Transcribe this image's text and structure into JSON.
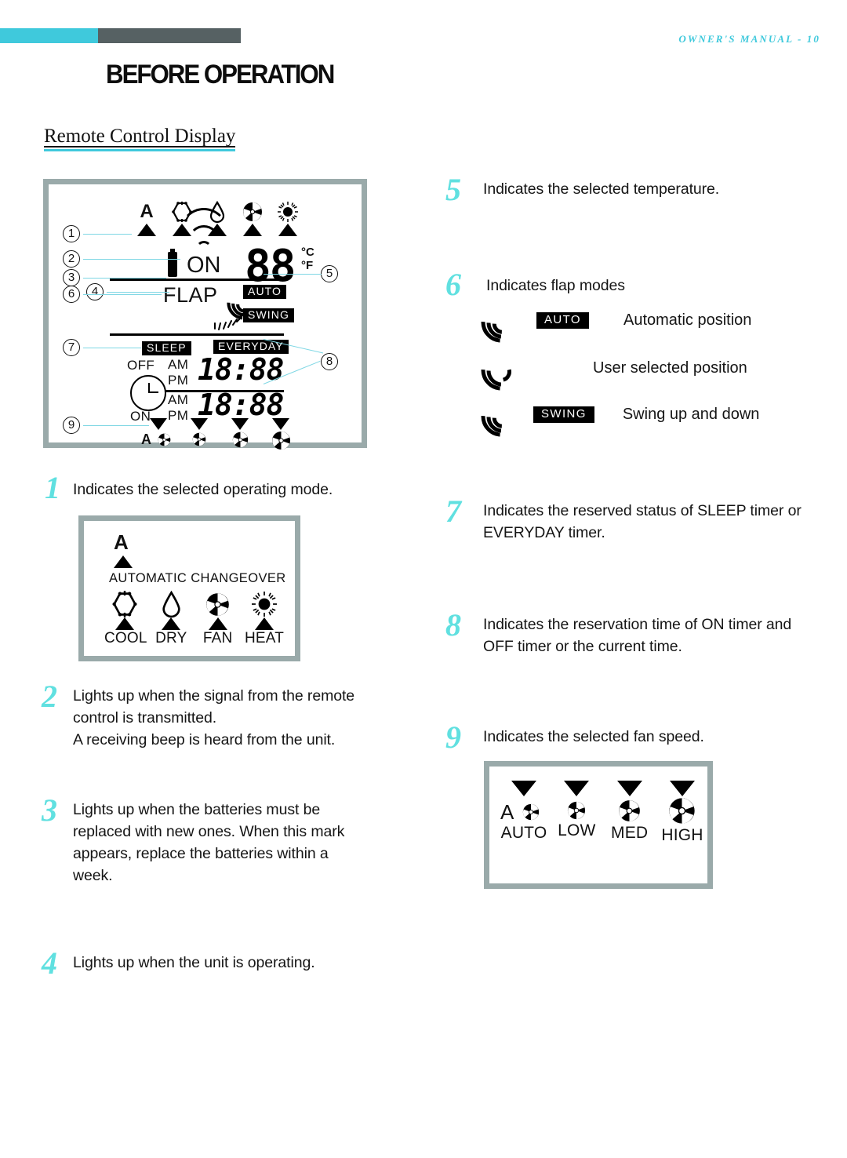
{
  "header": {
    "manual_tag": "OWNER'S MANUAL - 10",
    "page_title": "BEFORE OPERATION",
    "section_title": "Remote Control Display",
    "accent_cyan": "#3FC9DC",
    "accent_grey": "#566163",
    "number_cyan": "#60E0E0",
    "frame_grey": "#9AAAAA"
  },
  "lcd": {
    "mode_icons": [
      {
        "name": "automatic-changeover",
        "glyph": "A"
      },
      {
        "name": "cool-snowflake",
        "glyph": "snowflake"
      },
      {
        "name": "dry-droplet",
        "glyph": "droplet"
      },
      {
        "name": "fan-blade",
        "glyph": "fan"
      },
      {
        "name": "heat-sun",
        "glyph": "sun"
      }
    ],
    "on_label": "ON",
    "temp_value": "88",
    "temp_unit_c": "°C",
    "temp_unit_f": "°F",
    "flap_label": "FLAP",
    "auto_chip": "AUTO",
    "swing_chip": "SWING",
    "sleep_chip": "SLEEP",
    "everyday_chip": "EVERYDAY",
    "timer_off_label": "OFF",
    "timer_on_label": "ON",
    "am_label": "AM",
    "pm_label": "PM",
    "time_top": "18:88",
    "time_bottom": "18:88",
    "fan_speed_icons": [
      "A-fan",
      "fan-small",
      "fan-medium",
      "fan-large"
    ],
    "callouts": [
      "1",
      "2",
      "3",
      "4",
      "5",
      "6",
      "7",
      "8",
      "9"
    ]
  },
  "mode_box": {
    "auto_letter": "A",
    "auto_caption": "AUTOMATIC CHANGEOVER",
    "modes": [
      {
        "icon": "snowflake-icon",
        "label": "COOL"
      },
      {
        "icon": "droplet-icon",
        "label": "DRY"
      },
      {
        "icon": "fan-icon",
        "label": "FAN"
      },
      {
        "icon": "sun-icon",
        "label": "HEAT"
      }
    ]
  },
  "fan_box": {
    "speeds": [
      {
        "icon": "auto-fan-icon",
        "label": "AUTO"
      },
      {
        "icon": "low-fan-icon",
        "label": "LOW"
      },
      {
        "icon": "med-fan-icon",
        "label": "MED"
      },
      {
        "icon": "high-fan-icon",
        "label": "HIGH"
      }
    ]
  },
  "items": {
    "n1": {
      "num": "1",
      "text": "Indicates the selected operating mode."
    },
    "n2": {
      "num": "2",
      "line1": "Lights up when the signal from the remote",
      "line2": "control is transmitted.",
      "line3": "A receiving beep is heard from the unit."
    },
    "n3": {
      "num": "3",
      "line1": "Lights up when the batteries must be",
      "line2": "replaced with new ones. When this mark",
      "line3": "appears,  replace the batteries within a",
      "line4": "week."
    },
    "n4": {
      "num": "4",
      "text": "Lights up when the unit is operating."
    },
    "n5": {
      "num": "5",
      "text": "Indicates the selected temperature."
    },
    "n6": {
      "num": "6",
      "text": "Indicates flap modes",
      "rows": [
        {
          "chip": "AUTO",
          "desc": "Automatic position"
        },
        {
          "chip": "",
          "desc": "User selected position"
        },
        {
          "chip": "SWING",
          "desc": "Swing up and down"
        }
      ]
    },
    "n7": {
      "num": "7",
      "line1": "Indicates the reserved status of SLEEP timer or",
      "line2": "EVERYDAY timer."
    },
    "n8": {
      "num": "8",
      "line1": "Indicates the reservation time of ON timer and",
      "line2": "OFF timer or the current time."
    },
    "n9": {
      "num": "9",
      "text": "Indicates the selected fan speed."
    }
  }
}
